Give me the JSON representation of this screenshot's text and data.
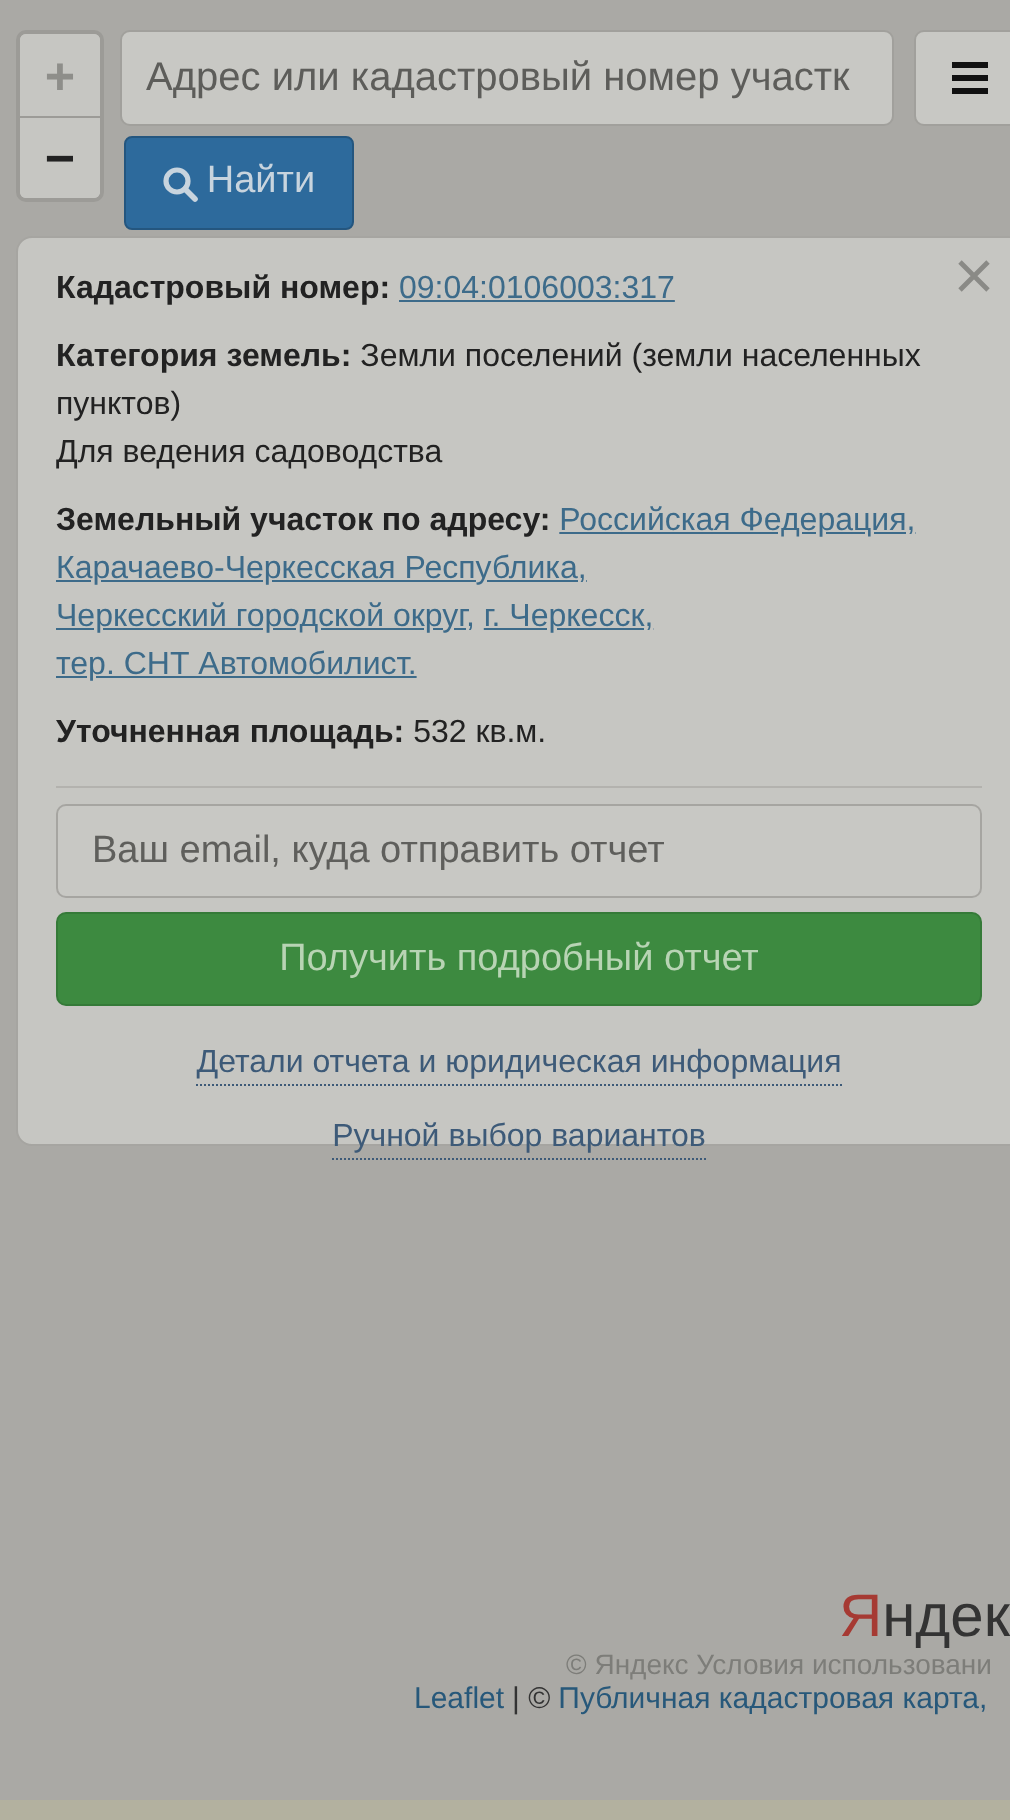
{
  "zoom_controls": [
    {
      "label": "+",
      "disabled": true
    },
    {
      "label": "−",
      "disabled": false
    }
  ],
  "search": {
    "placeholder": "Адрес или кадастровый номер участк",
    "button": "Найти"
  },
  "popup": {
    "rows": [
      {
        "kind": "field",
        "label": "Кадастровый номер:",
        "links": [
          "09:04:0106003:317"
        ]
      },
      {
        "kind": "field",
        "label": "Категория земель:",
        "value": "Земли поселений (земли населенных пунктов)"
      },
      {
        "kind": "plain",
        "value": "Для ведения садоводства"
      },
      {
        "kind": "field",
        "label": "Земельный участок по адресу:",
        "links": [
          "Российская Федерация,",
          "Карачаево-Черкесская Республика,",
          "Черкесский городской округ,",
          "г. Черкесск,",
          "тер. СНТ Автомобилист."
        ]
      },
      {
        "kind": "field",
        "label": "Уточненная площадь:",
        "value": "532 кв.м."
      }
    ],
    "email": {
      "placeholder": "Ваш email, куда отправить отчет"
    },
    "submit": "Получить подробный отчет",
    "links": [
      "Детали отчета и юридическая информация",
      "Ручной выбор вариантов"
    ]
  },
  "map": {
    "logo": "Яндек",
    "terms": "© Яндекс  Условия использовани",
    "attribution": [
      {
        "kind": "link",
        "text": "Leaflet"
      },
      {
        "kind": "text",
        "text": "| ©"
      },
      {
        "kind": "link",
        "text": "Публичная кадастровая карта,"
      }
    ]
  }
}
